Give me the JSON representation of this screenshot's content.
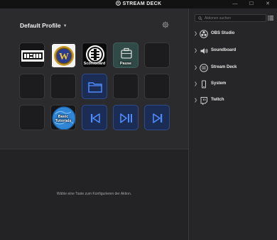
{
  "window": {
    "title": "STREAM DECK",
    "controls": {
      "minimize": "—",
      "maximize": "☐",
      "close": "✕"
    }
  },
  "profile": {
    "name": "Default Profile",
    "dropdown_icon": "chevron-down-icon",
    "settings_icon": "gear-icon"
  },
  "keys": [
    {
      "row": 1,
      "col": 1,
      "type": "image",
      "icon": "game-logo-icon",
      "label": ""
    },
    {
      "row": 1,
      "col": 2,
      "type": "image",
      "icon": "world-of-warcraft-icon",
      "label": ""
    },
    {
      "row": 1,
      "col": 3,
      "type": "image",
      "icon": "scoreboard-emblem-icon",
      "label": "Scoreboard"
    },
    {
      "row": 1,
      "col": 4,
      "type": "action",
      "icon": "briefcase-icon",
      "label": "Pause"
    },
    {
      "row": 1,
      "col": 5,
      "type": "empty",
      "label": ""
    },
    {
      "row": 2,
      "col": 1,
      "type": "empty",
      "label": ""
    },
    {
      "row": 2,
      "col": 2,
      "type": "empty",
      "label": ""
    },
    {
      "row": 2,
      "col": 3,
      "type": "action",
      "icon": "folder-icon",
      "label": ""
    },
    {
      "row": 2,
      "col": 4,
      "type": "empty",
      "label": ""
    },
    {
      "row": 2,
      "col": 5,
      "type": "empty",
      "label": ""
    },
    {
      "row": 3,
      "col": 1,
      "type": "empty",
      "label": ""
    },
    {
      "row": 3,
      "col": 2,
      "type": "image",
      "icon": "tutorial-globe-icon",
      "label": "Basic Tutorials"
    },
    {
      "row": 3,
      "col": 3,
      "type": "action",
      "icon": "previous-track-icon",
      "label": ""
    },
    {
      "row": 3,
      "col": 4,
      "type": "action",
      "icon": "play-pause-icon",
      "label": ""
    },
    {
      "row": 3,
      "col": 5,
      "type": "action",
      "icon": "next-track-icon",
      "label": ""
    }
  ],
  "hint": "Wähle eine Taste zum Konfigurieren der Aktion.",
  "panel": {
    "search_placeholder": "Aktionen suchen",
    "list_view_icon": "list-view-icon",
    "categories": [
      {
        "label": "OBS Studio",
        "icon": "obs-icon"
      },
      {
        "label": "Soundboard",
        "icon": "speaker-icon"
      },
      {
        "label": "Stream Deck",
        "icon": "stream-deck-icon"
      },
      {
        "label": "System",
        "icon": "phone-icon"
      },
      {
        "label": "Twitch",
        "icon": "twitch-icon"
      }
    ]
  },
  "colors": {
    "accent_blue": "#2e6dff",
    "media_key_bg": "#1b2d55",
    "pause_key_bg": "#2f4a47"
  }
}
